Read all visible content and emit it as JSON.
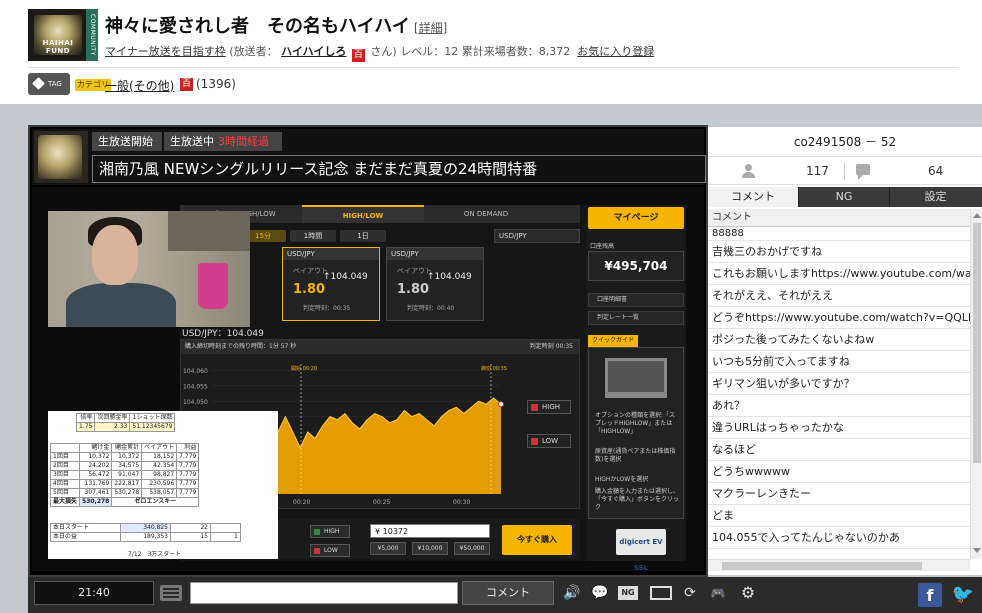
{
  "header": {
    "community_logo_text": "HAIHAI FUND",
    "community_stripe": "COMMUNITY",
    "title": "神々に愛されし者　その名もハイハイ",
    "detail_link": "[詳細]",
    "sub_goal": "マイナー放送を目指す枠",
    "sub_caster_prefix": "(放送者：",
    "caster_name": "ハイハイしろ",
    "caster_badge": "百",
    "sub_caster_suffix": "さん)",
    "level": "レベル：12",
    "visitors": "累計来場者数：8,372",
    "favorite_link": "お気に入り登録"
  },
  "tags": {
    "tag_button": "TAG",
    "category_badge": "カテゴリ",
    "category": "一般(その他)",
    "category_badge2": "百",
    "count": "(1396)"
  },
  "broadcast": {
    "label_start": "生放送開始",
    "label_live": "生放送中",
    "elapsed": "3時間経過",
    "title": "湘南乃風 NEWシングルリリース記念 まだまだ真夏の24時間特番"
  },
  "trading": {
    "tab1": "スプレッドHIGH/LOW",
    "tab2": "HIGH/LOW",
    "tab3": "ON DEMAND",
    "subtab1": "15分",
    "subtab2": "1時間",
    "subtab3": "1日",
    "pair_select": "USD/JPY",
    "card1": {
      "pair": "USD/JPY",
      "time": "15m",
      "caption": "ペイアウト",
      "price": "↑104.049",
      "multiplier": "1.80",
      "footer": "判定時刻：00:35"
    },
    "card2": {
      "pair": "USD/JPY",
      "time": "15m",
      "caption": "ペイアウト",
      "price": "↑104.049",
      "multiplier": "1.80",
      "footer": "判定時刻：00:40"
    },
    "spot": "USD/JPY：104.049",
    "chart_header": "購入締切時刻までの残り時間：1分 57 秒",
    "chart_header_right": "判定時刻 00:35",
    "high_btn": "HIGH",
    "low_btn": "LOW",
    "bb_high": "HIGH",
    "bb_low": "LOW",
    "amount": "¥ 10372",
    "chip1": "¥5,000",
    "chip2": "¥10,000",
    "chip3": "¥50,000",
    "buy": "今すぐ購入",
    "mypage": "マイページ",
    "account_label": "口座残高",
    "balance": "¥495,704",
    "menu1": "口座明細書",
    "menu2": "判定レート一覧",
    "quick_guide": "クイックガイド",
    "qg_step1": "オプションの種類を選択:「スプレッドHIGHLOW」または「HIGHLOW」",
    "qg_step2": "原資産(通貨ペアまたは株価指数)を選択",
    "qg_step3": "HIGHかLOWを選択",
    "qg_step4": "購入金額を入力または選択し、「今すぐ購入」ボタンをクリック",
    "digicert": "digicert EV SSL"
  },
  "sheet": {
    "rate_headers": [
      "倍率",
      "次回勝金率",
      "1ショット保数"
    ],
    "rate_values": [
      "1.75",
      "2.33",
      "51.12345679"
    ],
    "col_headers": [
      "",
      "賭け金",
      "賭金累計",
      "ペイアウト",
      "利益"
    ],
    "rows": [
      [
        "1回目",
        "10,372",
        "10,372",
        "18,152",
        "7,779"
      ],
      [
        "2回目",
        "24,202",
        "34,575",
        "42,354",
        "7,779"
      ],
      [
        "3回目",
        "56,472",
        "91,047",
        "98,827",
        "7,779"
      ],
      [
        "4回目",
        "131,769",
        "222,817",
        "230,596",
        "7,779"
      ],
      [
        "5回目",
        "307,461",
        "530,278",
        "538,057",
        "7,779"
      ]
    ],
    "loss_label": "最大損失",
    "loss_value": "530,278",
    "zero_label": "ゼロエンスキー",
    "start_label": "本日スタート",
    "start_value": "340,825",
    "start_num": "22",
    "gain_label": "本日の益",
    "gain_value": "189,353",
    "gain_num": "15",
    "gain_num2": "1",
    "footer": "7/12　3万スタート"
  },
  "chart_data": {
    "type": "area",
    "x": [
      0,
      1,
      2,
      3,
      4,
      5,
      6,
      7,
      8,
      9,
      10,
      11,
      12,
      13,
      14,
      15,
      16,
      17,
      18,
      19,
      20,
      21,
      22,
      23,
      24,
      25,
      26,
      27,
      28,
      29,
      30,
      31,
      32,
      33,
      34,
      35,
      36,
      37,
      38,
      39
    ],
    "values": [
      104.02,
      104.03,
      104.04,
      104.035,
      104.03,
      104.04,
      104.045,
      104.04,
      104.035,
      104.04,
      104.045,
      104.04,
      104.035,
      104.04,
      104.038,
      104.042,
      104.045,
      104.044,
      104.046,
      104.043,
      104.041,
      104.044,
      104.046,
      104.045,
      104.043,
      104.044,
      104.047,
      104.045,
      104.046,
      104.044,
      104.042,
      104.045,
      104.047,
      104.048,
      104.046,
      104.048,
      104.05,
      104.049,
      104.051,
      104.049
    ],
    "yticks": [
      "104.060",
      "104.055",
      "104.050",
      "104.045",
      "104.040"
    ],
    "xticks": [
      "00:20",
      "00:25",
      "00:30"
    ],
    "markers": [
      "開始 00:20",
      "締切 00:35"
    ],
    "ylim": [
      104.02,
      104.062
    ],
    "colors": {
      "area": "#f5a800",
      "line": "#ffcc44"
    }
  },
  "controls": {
    "time": "21:40",
    "comment_placeholder": "",
    "comment_button": "コメント",
    "nico_icon_label": "NG"
  },
  "right_panel": {
    "live_id": "co2491508 － 52",
    "viewers": "117",
    "comments": "64",
    "tab_comment": "コメント",
    "tab_ng": "NG",
    "tab_settings": "設定",
    "list_header": "コメント",
    "comments_list": [
      "88888",
      "吉幾三のおかげですね",
      "これもお願いしますhttps://www.youtube.com/watch?v=",
      "それがええ、それがええ",
      "どうぞhttps://www.youtube.com/watch?v=QQLR_CWy",
      "ポジった後ってみたくないよねw",
      "いつも5分前で入ってますね",
      "ギリマン狙いが多いですか？",
      "あれ？",
      "違うURLはっちゃったかな",
      "なるほど",
      "どうちwwwww",
      "マクラーレンきたー",
      "どま",
      "104.055で入ってたんじゃないのかあ"
    ]
  }
}
